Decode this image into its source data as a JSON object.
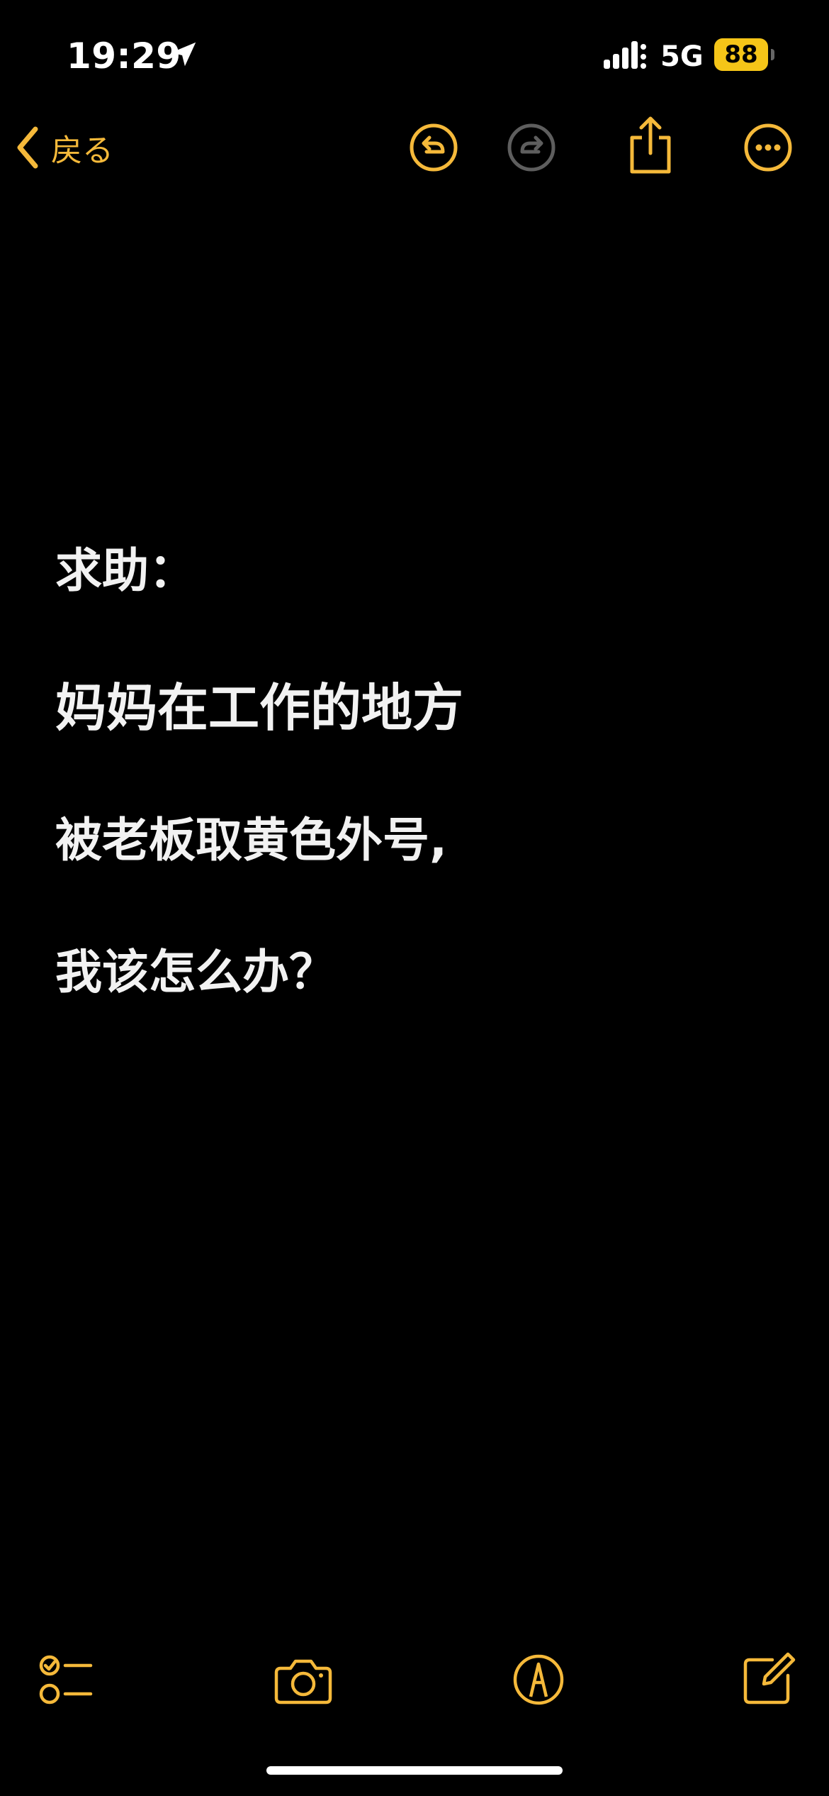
{
  "status_bar": {
    "time": "19:29",
    "network": "5G",
    "battery": "88"
  },
  "nav": {
    "back_label": "戻る",
    "accent_color": "#f5b93a"
  },
  "note": {
    "heading": "求助：",
    "lines": [
      "妈妈在工作的地方",
      "被老板取黄色外号,",
      "我该怎么办？"
    ]
  },
  "toolbar": {
    "icons": [
      "checklist-icon",
      "camera-icon",
      "markup-icon",
      "compose-icon"
    ]
  }
}
